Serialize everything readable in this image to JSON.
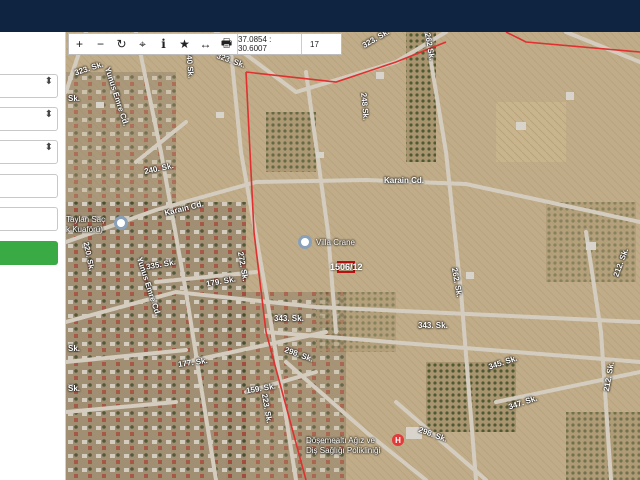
{
  "toolbar": {
    "zoom_in": "+",
    "zoom_out": "−",
    "refresh": "↻",
    "locate": "⌖",
    "info": "i",
    "star": "★",
    "measure": "↔",
    "print": "🖶",
    "coordinates": "37.0854 : 30.6007",
    "zoom_level": "17"
  },
  "sidebar": {
    "selects": [
      "",
      "",
      ""
    ],
    "caret": "⬍",
    "inputs": [
      "",
      ""
    ],
    "button": ""
  },
  "map": {
    "streets": {
      "s240": "240 Sk.",
      "s240b": "240. Sk.",
      "s323": "323. Sk.",
      "s323b": "323. Sk.",
      "yunus1": "Yunus Emre Cd.",
      "yunus2": "Yunus Emre Cd.",
      "s248": "248 Sk.",
      "s262": "262 Sk.",
      "s262b": "262. Sk.",
      "karain1": "Karain Cd.",
      "karain2": "Karain Cd.",
      "s220": "220. Sk.",
      "s335": "335. Sk.",
      "s179": "179. Sk.",
      "s272": "272. Sk.",
      "s343a": "343. Sk.",
      "s343b": "343. Sk.",
      "s343c": "343. Sk.",
      "s177": "177. Sk.",
      "s298a": "298. Sk.",
      "s298b": "298. Sk.",
      "s345": "345. Sk.",
      "s347": "347. Sk.",
      "s212a": "212. Sk.",
      "s212b": "212. Sk.",
      "s159": "159. Sk.",
      "s223": "223. Sk.",
      "sk_left1": "Sk.",
      "sk_left2": "Sk.",
      "sk_left3": "Sk."
    },
    "pois": {
      "villa": "Villa Crane",
      "taylan1": "Taylan Saç",
      "taylan2": "k Kuaförü)",
      "clinic1": "Döşemealtı Ağız ve",
      "clinic2": "Diş Sağlığı Polikliniği"
    },
    "parcel": "1506/12",
    "hospital_letter": "H"
  }
}
